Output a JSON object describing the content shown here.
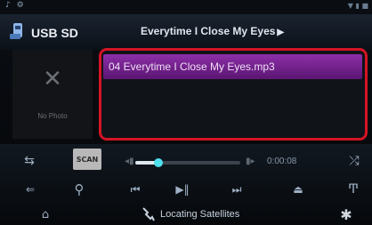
{
  "status_bar": {
    "left_glyphs": "♪ ⚙",
    "right_text": "▼ ▮ ■"
  },
  "header": {
    "source_label": "USB SD",
    "track_title": "Everytime I Close My Eyes",
    "title_arrow": "▶"
  },
  "artwork": {
    "placeholder_mark": "✕",
    "placeholder_label": "No Photo"
  },
  "playlist": {
    "selected_item": "04 Everytime I Close My Eyes.mp3"
  },
  "controls": {
    "repeat_icon": "⇆",
    "scan_label": "SCAN",
    "seek_left_icon": "◂▮",
    "seek_right_icon": "▮▸",
    "time": "0:00:08",
    "playback_progress_fraction": 0.22,
    "shuffle_icon": "⤮",
    "back_icon": "⇐",
    "search_icon": "⚲",
    "prev_icon": "⏮",
    "playpause_icon": "▶‖",
    "next_icon": "⏭",
    "eject_icon": "⏏",
    "tone_icon": "Ͳ"
  },
  "bottom_bar": {
    "nav_icon": "⌂",
    "nav_status": "Locating Satellites",
    "settings_icon": "✱"
  },
  "colors": {
    "highlight_frame": "#d41424",
    "selected_row": "#7b2596",
    "progress_thumb": "#4fe0ee"
  }
}
